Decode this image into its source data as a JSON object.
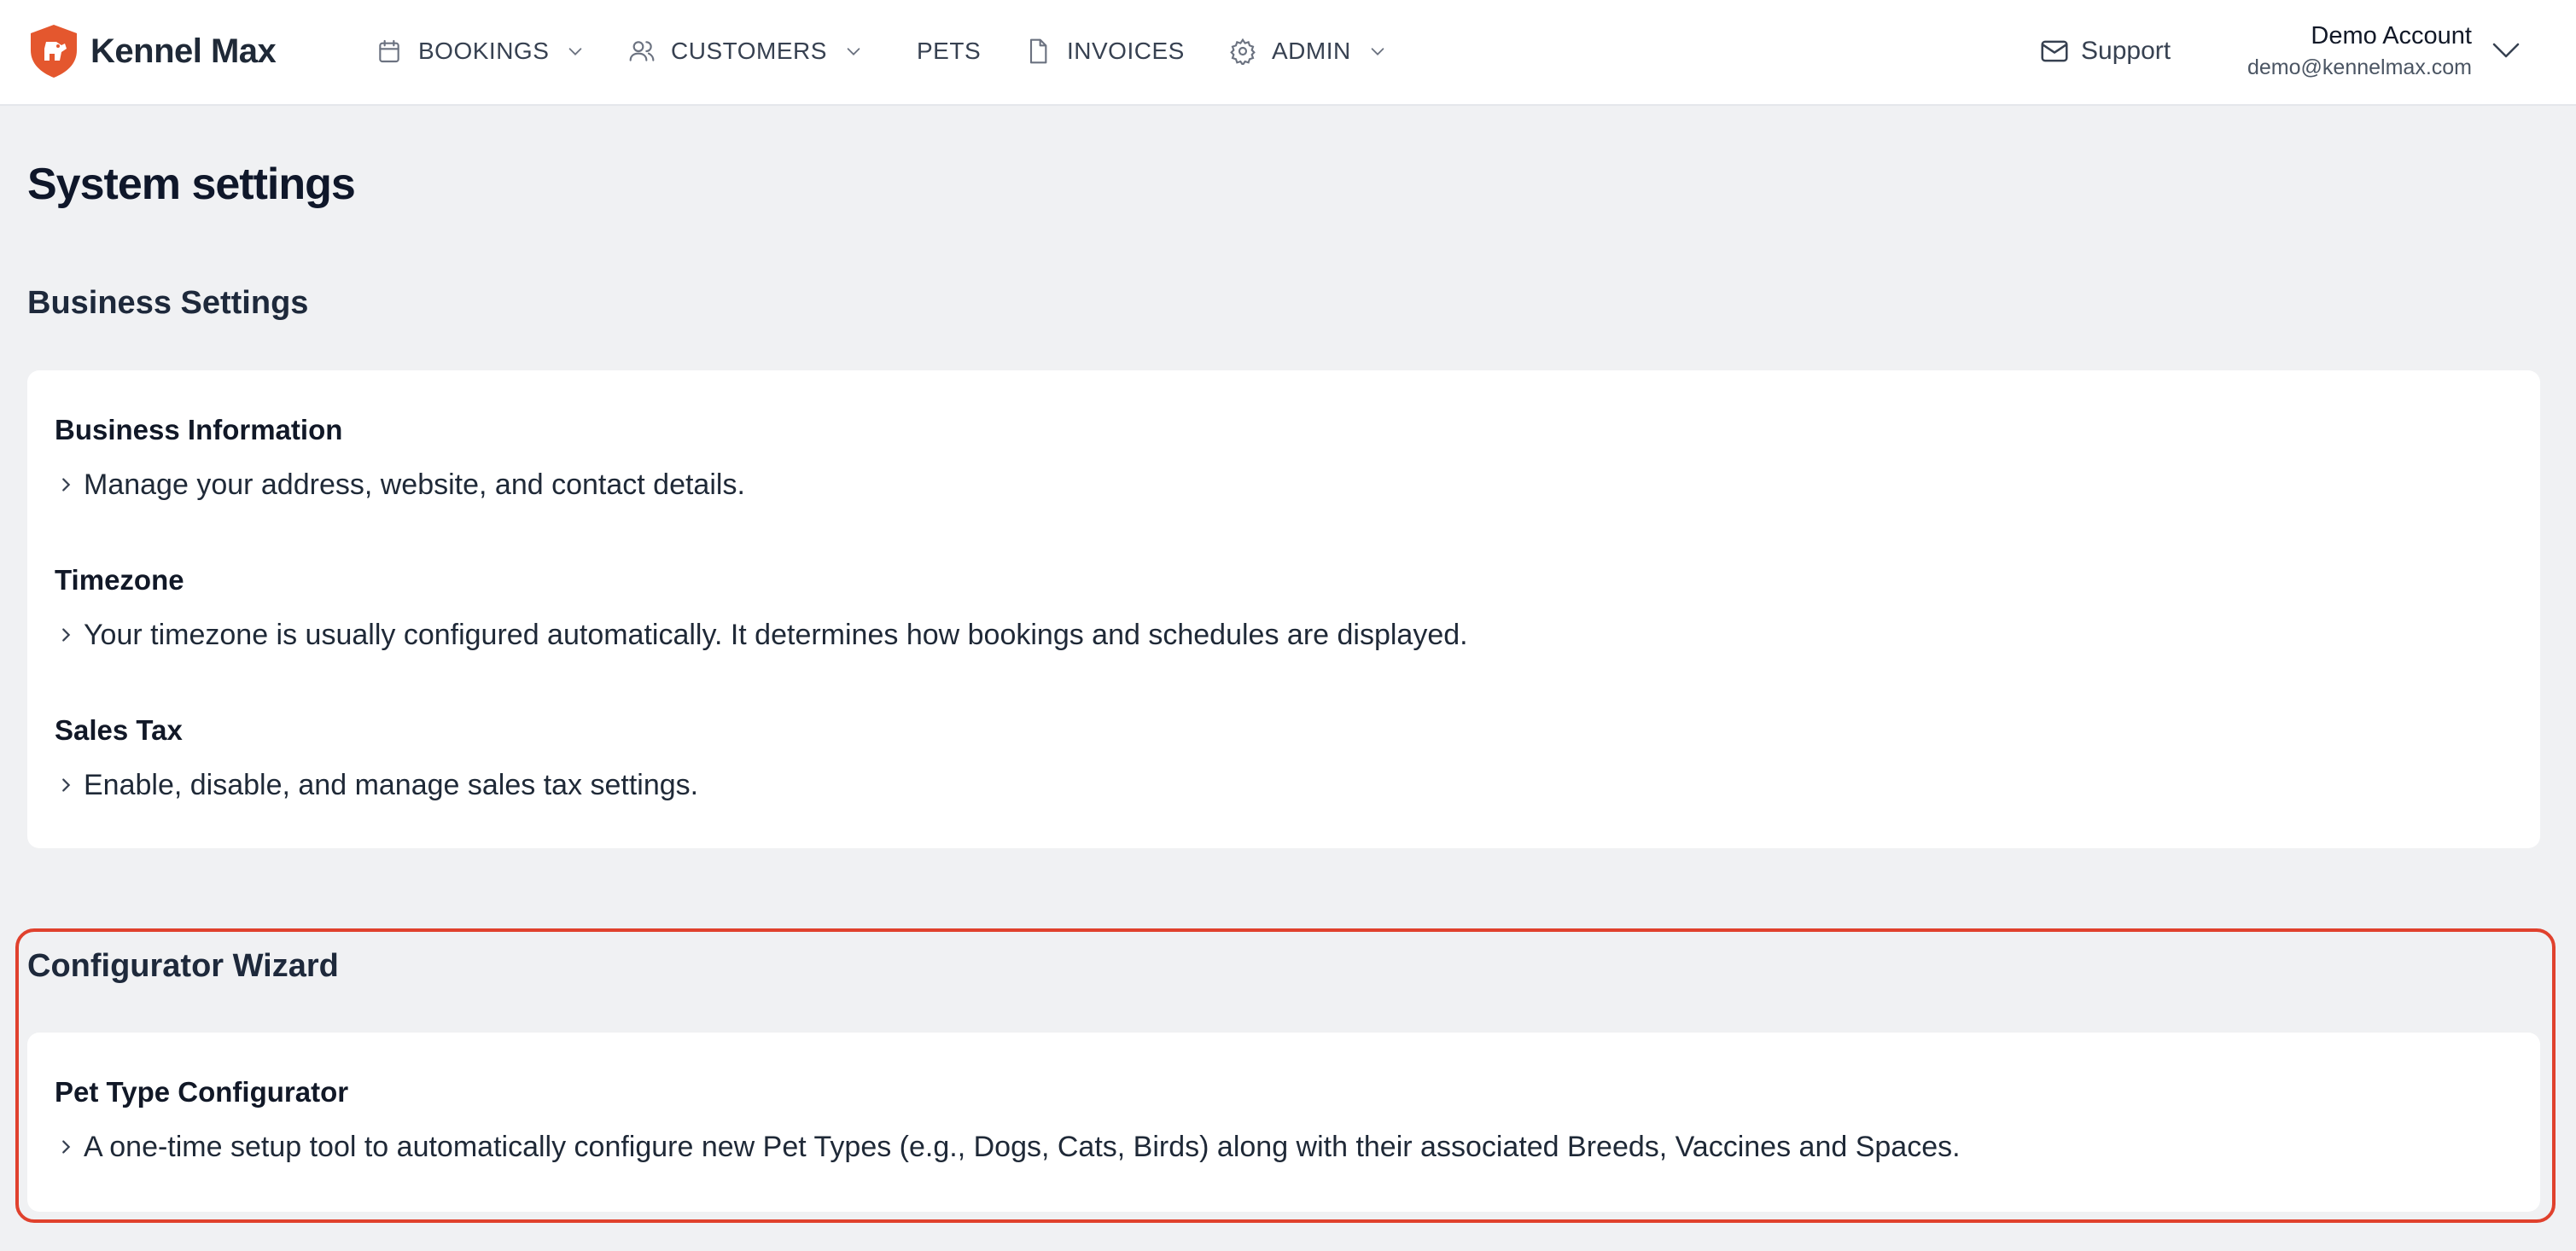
{
  "brand": {
    "name": "Kennel Max",
    "accent": "#e4572e"
  },
  "nav": [
    {
      "label": "BOOKINGS",
      "icon": "calendar-icon",
      "dropdown": true
    },
    {
      "label": "CUSTOMERS",
      "icon": "users-icon",
      "dropdown": true
    },
    {
      "label": "PETS",
      "icon": "",
      "dropdown": false
    },
    {
      "label": "INVOICES",
      "icon": "document-icon",
      "dropdown": false
    },
    {
      "label": "ADMIN",
      "icon": "gear-icon",
      "dropdown": true
    }
  ],
  "support": {
    "label": "Support",
    "icon": "mail-icon"
  },
  "account": {
    "name": "Demo Account",
    "email": "demo@kennelmax.com"
  },
  "page": {
    "title": "System settings"
  },
  "business_settings": {
    "heading": "Business Settings",
    "items": [
      {
        "title": "Business Information",
        "description": "Manage your address, website, and contact details."
      },
      {
        "title": "Timezone",
        "description": "Your timezone is usually configured automatically. It determines how bookings and schedules are displayed."
      },
      {
        "title": "Sales Tax",
        "description": "Enable, disable, and manage sales tax settings."
      }
    ]
  },
  "configurator": {
    "heading": "Configurator Wizard",
    "highlight_color": "#e0412d",
    "items": [
      {
        "title": "Pet Type Configurator",
        "description": "A one-time setup tool to automatically configure new Pet Types (e.g., Dogs, Cats, Birds) along with their associated Breeds, Vaccines and Spaces."
      }
    ]
  }
}
